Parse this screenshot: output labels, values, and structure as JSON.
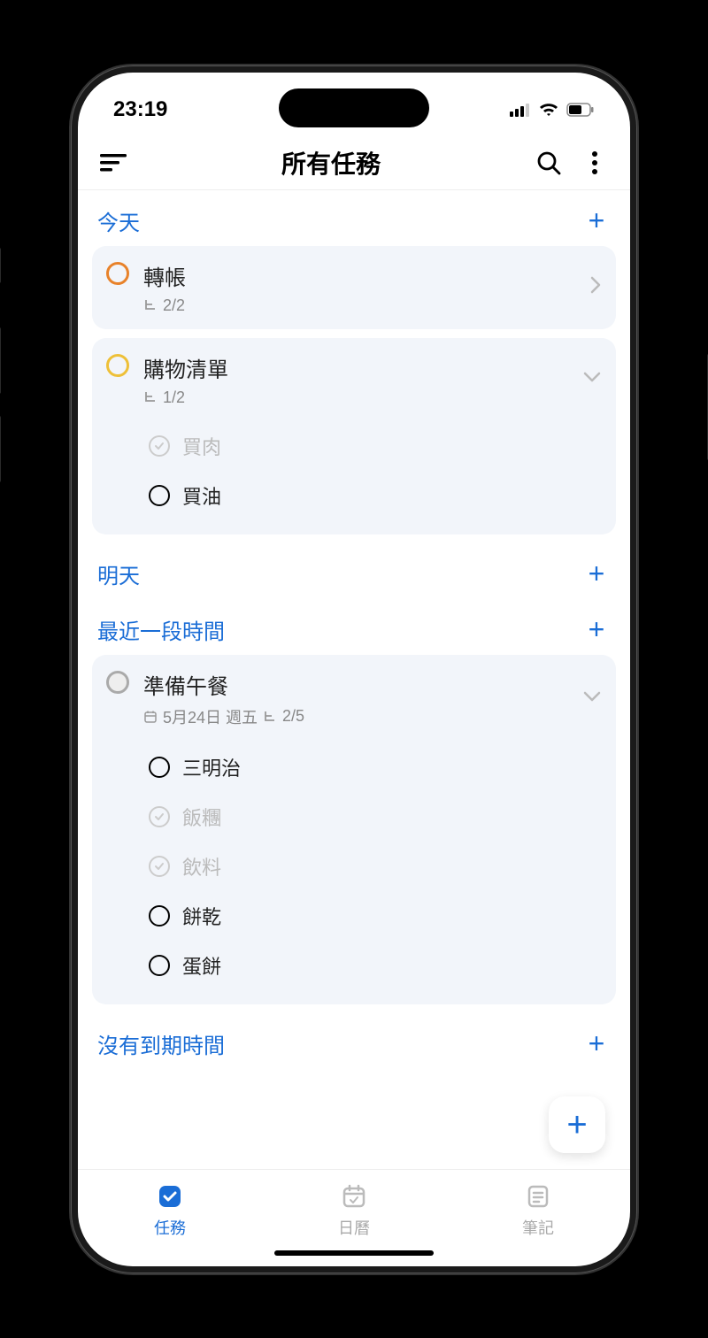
{
  "status": {
    "time": "23:19"
  },
  "header": {
    "title": "所有任務"
  },
  "sections": [
    {
      "title": "今天",
      "tasks": [
        {
          "title": "轉帳",
          "color": "orange",
          "subtask_count": "2/2",
          "expanded": false
        },
        {
          "title": "購物清單",
          "color": "yellow",
          "subtask_count": "1/2",
          "expanded": true,
          "subtasks": [
            {
              "text": "買肉",
              "done": true,
              "color": "grey"
            },
            {
              "text": "買油",
              "done": false,
              "color": "yellow"
            }
          ]
        }
      ]
    },
    {
      "title": "明天",
      "tasks": []
    },
    {
      "title": "最近一段時間",
      "tasks": [
        {
          "title": "準備午餐",
          "color": "grey",
          "date": "5月24日 週五",
          "subtask_count": "2/5",
          "expanded": true,
          "subtasks": [
            {
              "text": "三明治",
              "done": false,
              "color": "dark"
            },
            {
              "text": "飯糰",
              "done": true,
              "color": "grey"
            },
            {
              "text": "飲料",
              "done": true,
              "color": "grey"
            },
            {
              "text": "餅乾",
              "done": false,
              "color": "dark"
            },
            {
              "text": "蛋餅",
              "done": false,
              "color": "dark"
            }
          ]
        }
      ]
    },
    {
      "title": "沒有到期時間",
      "tasks": []
    }
  ],
  "nav": {
    "items": [
      {
        "label": "任務",
        "active": true
      },
      {
        "label": "日曆",
        "active": false
      },
      {
        "label": "筆記",
        "active": false
      }
    ]
  }
}
